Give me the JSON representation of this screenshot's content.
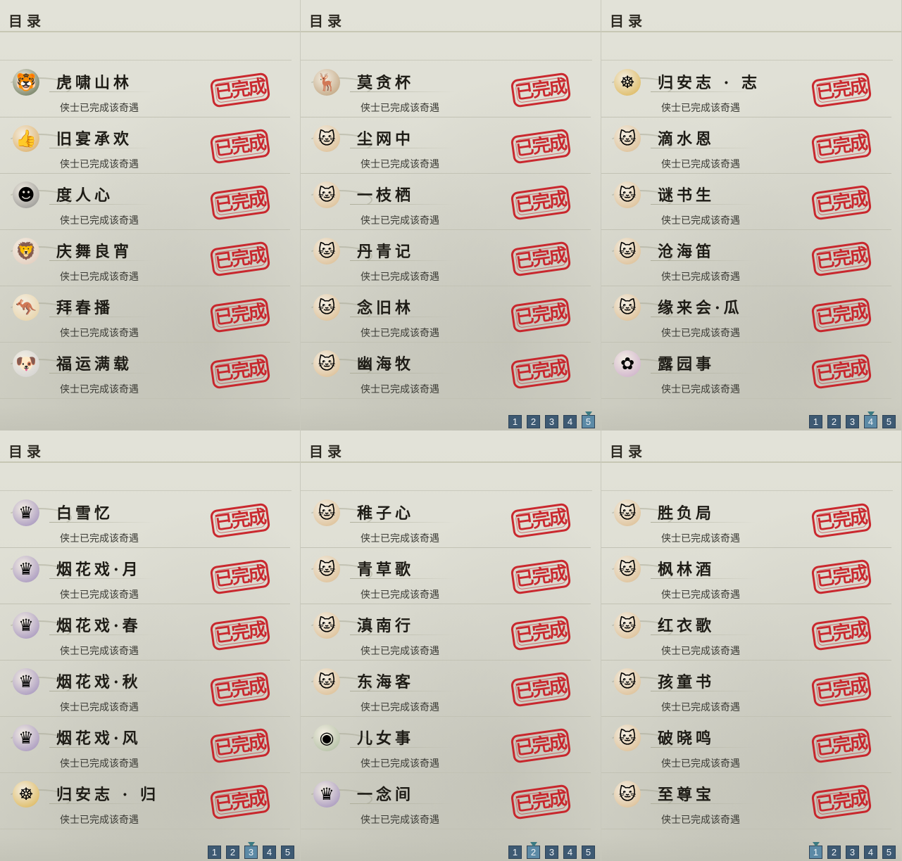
{
  "panels": [
    {
      "title": "目录",
      "items": [
        {
          "name": "虎啸山林",
          "status": "侠士已完成该奇遇",
          "icon": "tiger-icon",
          "glyph": "🐯",
          "bg": "#5a6a4a"
        },
        {
          "name": "旧宴承欢",
          "status": "侠士已完成该奇遇",
          "icon": "thumbs-up-icon",
          "glyph": "👍",
          "bg": "#d9a85a"
        },
        {
          "name": "度人心",
          "status": "侠士已完成该奇遇",
          "icon": "ghost-icon",
          "glyph": "☻",
          "bg": "#8a8a88"
        },
        {
          "name": "庆舞良宵",
          "status": "侠士已完成该奇遇",
          "icon": "lion-dance-icon",
          "glyph": "🦁",
          "bg": "#e0c8b8"
        },
        {
          "name": "拜春播",
          "status": "侠士已完成该奇遇",
          "icon": "kangaroo-icon",
          "glyph": "🦘",
          "bg": "#e6cfa0"
        },
        {
          "name": "福运满载",
          "status": "侠士已完成该奇遇",
          "icon": "dog-icon",
          "glyph": "🐶",
          "bg": "#cfcfcf"
        }
      ],
      "pages": [],
      "active_page": ""
    },
    {
      "title": "目录",
      "items": [
        {
          "name": "莫贪杯",
          "status": "侠士已完成该奇遇",
          "icon": "deer-icon",
          "glyph": "🦌",
          "bg": "#b99a72"
        },
        {
          "name": "尘网中",
          "status": "侠士已完成该奇遇",
          "icon": "cat-icon",
          "glyph": "🐱",
          "bg": "#d9b88a"
        },
        {
          "name": "一枝栖",
          "status": "侠士已完成该奇遇",
          "icon": "cat-icon",
          "glyph": "🐱",
          "bg": "#d9b88a"
        },
        {
          "name": "丹青记",
          "status": "侠士已完成该奇遇",
          "icon": "cat-icon",
          "glyph": "🐱",
          "bg": "#d9b88a"
        },
        {
          "name": "念旧林",
          "status": "侠士已完成该奇遇",
          "icon": "cat-icon",
          "glyph": "🐱",
          "bg": "#d9b88a"
        },
        {
          "name": "幽海牧",
          "status": "侠士已完成该奇遇",
          "icon": "cat-icon",
          "glyph": "🐱",
          "bg": "#d9b88a"
        }
      ],
      "pages": [
        "1",
        "2",
        "3",
        "4",
        "5"
      ],
      "active_page": "5"
    },
    {
      "title": "目录",
      "items": [
        {
          "name": "归安志 · 志",
          "status": "侠士已完成该奇遇",
          "icon": "golden-buddha-icon",
          "glyph": "☸",
          "bg": "#d9b04a"
        },
        {
          "name": "滴水恩",
          "status": "侠士已完成该奇遇",
          "icon": "cat-icon",
          "glyph": "🐱",
          "bg": "#d9b88a"
        },
        {
          "name": "谜书生",
          "status": "侠士已完成该奇遇",
          "icon": "cat-icon",
          "glyph": "🐱",
          "bg": "#d9b88a"
        },
        {
          "name": "沧海笛",
          "status": "侠士已完成该奇遇",
          "icon": "cat-icon",
          "glyph": "🐱",
          "bg": "#d9b88a"
        },
        {
          "name": "缘来会·瓜",
          "status": "侠士已完成该奇遇",
          "icon": "cat-icon",
          "glyph": "🐱",
          "bg": "#d9b88a"
        },
        {
          "name": "露园事",
          "status": "侠士已完成该奇遇",
          "icon": "flower-fairy-icon",
          "glyph": "✿",
          "bg": "#c9a8c8"
        }
      ],
      "pages": [
        "1",
        "2",
        "3",
        "4",
        "5"
      ],
      "active_page": "4"
    },
    {
      "title": "目录",
      "items": [
        {
          "name": "白雪忆",
          "status": "侠士已完成该奇遇",
          "icon": "lady-portrait-icon",
          "glyph": "♛",
          "bg": "#9a88b8"
        },
        {
          "name": "烟花戏·月",
          "status": "侠士已完成该奇遇",
          "icon": "lady-portrait-icon",
          "glyph": "♛",
          "bg": "#9a88b8"
        },
        {
          "name": "烟花戏·春",
          "status": "侠士已完成该奇遇",
          "icon": "lady-portrait-icon",
          "glyph": "♛",
          "bg": "#9a88b8"
        },
        {
          "name": "烟花戏·秋",
          "status": "侠士已完成该奇遇",
          "icon": "lady-portrait-icon",
          "glyph": "♛",
          "bg": "#9a88b8"
        },
        {
          "name": "烟花戏·风",
          "status": "侠士已完成该奇遇",
          "icon": "lady-portrait-icon",
          "glyph": "♛",
          "bg": "#9a88b8"
        },
        {
          "name": "归安志 · 归",
          "status": "侠士已完成该奇遇",
          "icon": "golden-buddha-icon",
          "glyph": "☸",
          "bg": "#d9b04a"
        }
      ],
      "pages": [
        "1",
        "2",
        "3",
        "4",
        "5"
      ],
      "active_page": "3"
    },
    {
      "title": "目录",
      "items": [
        {
          "name": "稚子心",
          "status": "侠士已完成该奇遇",
          "icon": "cat-icon",
          "glyph": "🐱",
          "bg": "#d9b88a"
        },
        {
          "name": "青草歌",
          "status": "侠士已完成该奇遇",
          "icon": "cat-icon",
          "glyph": "🐱",
          "bg": "#d9b88a"
        },
        {
          "name": "滇南行",
          "status": "侠士已完成该奇遇",
          "icon": "cat-icon",
          "glyph": "🐱",
          "bg": "#d9b88a"
        },
        {
          "name": "东海客",
          "status": "侠士已完成该奇遇",
          "icon": "cat-icon",
          "glyph": "🐱",
          "bg": "#d9b88a"
        },
        {
          "name": "儿女事",
          "status": "侠士已完成该奇遇",
          "icon": "moon-gem-icon",
          "glyph": "◉",
          "bg": "#a8b89a"
        },
        {
          "name": "一念间",
          "status": "侠士已完成该奇遇",
          "icon": "lady-portrait-icon",
          "glyph": "♛",
          "bg": "#9a88b8"
        }
      ],
      "pages": [
        "1",
        "2",
        "3",
        "4",
        "5"
      ],
      "active_page": "2"
    },
    {
      "title": "目录",
      "items": [
        {
          "name": "胜负局",
          "status": "侠士已完成该奇遇",
          "icon": "cat-icon",
          "glyph": "🐱",
          "bg": "#d9b88a"
        },
        {
          "name": "枫林酒",
          "status": "侠士已完成该奇遇",
          "icon": "cat-icon",
          "glyph": "🐱",
          "bg": "#d9b88a"
        },
        {
          "name": "红衣歌",
          "status": "侠士已完成该奇遇",
          "icon": "cat-icon",
          "glyph": "🐱",
          "bg": "#d9b88a"
        },
        {
          "name": "孩童书",
          "status": "侠士已完成该奇遇",
          "icon": "cat-icon",
          "glyph": "🐱",
          "bg": "#d9b88a"
        },
        {
          "name": "破晓鸣",
          "status": "侠士已完成该奇遇",
          "icon": "cat-icon",
          "glyph": "🐱",
          "bg": "#d9b88a"
        },
        {
          "name": "至尊宝",
          "status": "侠士已完成该奇遇",
          "icon": "cat-icon",
          "glyph": "🐱",
          "bg": "#d9b88a"
        }
      ],
      "pages": [
        "1",
        "2",
        "3",
        "4",
        "5"
      ],
      "active_page": "1"
    }
  ],
  "stamp_label": "已完成",
  "stamp_color": "#c8161e",
  "page_button_color": "#3e5a73"
}
